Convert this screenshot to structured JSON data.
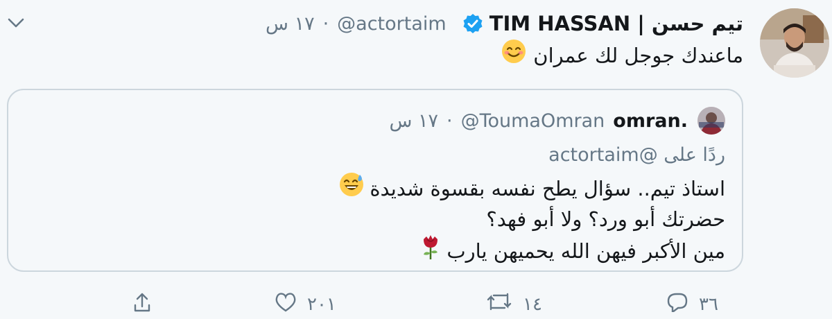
{
  "tweet": {
    "display_name": "تيم حسن | TIM HASSAN",
    "handle": "@actortaim",
    "separator": "·",
    "time": "١٧ س",
    "text": "ماعندك جوجل لك عمران",
    "emoji": "smiling-face-icon"
  },
  "quoted": {
    "display_name": "omran.",
    "handle": "@ToumaOmran",
    "separator": "·",
    "time": "١٧ س",
    "reply_prefix": "ردًا على",
    "reply_mention": "@actortaim",
    "lines": [
      "استاذ تيم.. سؤال يطح نفسه بقسوة شديدة",
      "حضرتك أبو ورد؟ ولا أبو فهد؟",
      "مين الأكبر فيهن الله يحميهن يارب"
    ],
    "line_emojis": [
      "sweat-smile-icon",
      "",
      "rose-icon"
    ]
  },
  "actions": {
    "reply_count": "٣٦",
    "retweet_count": "١٤",
    "like_count": "٢٠١",
    "share": ""
  },
  "colors": {
    "verified": "#1da1f2",
    "muted": "#657786",
    "border": "#ccd6dd",
    "background": "#f5f8fa"
  }
}
